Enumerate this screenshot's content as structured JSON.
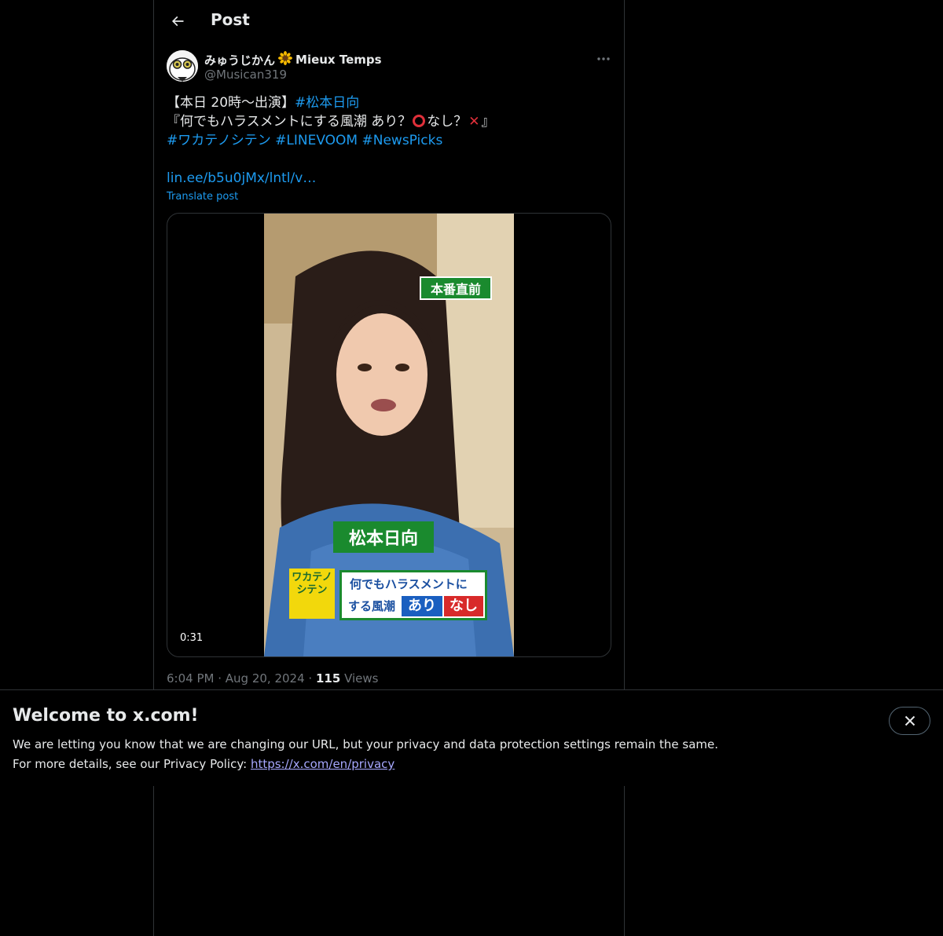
{
  "header": {
    "title": "Post"
  },
  "post": {
    "author": {
      "display_name": "みゅうじかん",
      "name_suffix": "Mieux Temps",
      "name_emoji": "🌻",
      "handle": "@Musican319"
    },
    "text": {
      "line1_prefix": "【本日 20時〜出演】",
      "line1_tag": "#松本日向",
      "line2_prefix": "『何でもハラスメントにする風潮 あり？",
      "line2_mid": "なし？",
      "line2_suffix": "』",
      "tags": [
        "#ワカテノシテン",
        "#LINEVOOM",
        "#NewsPicks"
      ],
      "link": "lin.ee/b5u0jMx/lntl/v…"
    },
    "translate_label": "Translate post",
    "video": {
      "duration": "0:31",
      "overlay_top": "本番直前",
      "overlay_name": "松本日向",
      "overlay_logo": "ワカテノシテン",
      "overlay_line1": "何でもハラスメントに",
      "overlay_line2": "する風潮",
      "overlay_ari": "あり",
      "overlay_nashi": "なし"
    },
    "meta": {
      "time": "6:04 PM",
      "date": "Aug 20, 2024",
      "views_count": "115",
      "views_label": "Views"
    }
  },
  "banner": {
    "title": "Welcome to x.com!",
    "line1": "We are letting you know that we are changing our URL, but your privacy and data protection settings remain the same.",
    "line2_prefix": "For more details, see our Privacy Policy: ",
    "link": "https://x.com/en/privacy"
  },
  "icons": [
    "back-arrow-icon",
    "more-icon",
    "close-icon",
    "sunflower-icon"
  ],
  "colors": {
    "background": "#000000",
    "text": "#e7e9ea",
    "secondary": "#71767b",
    "accent": "#1d9bf0",
    "border": "#2f3336"
  }
}
